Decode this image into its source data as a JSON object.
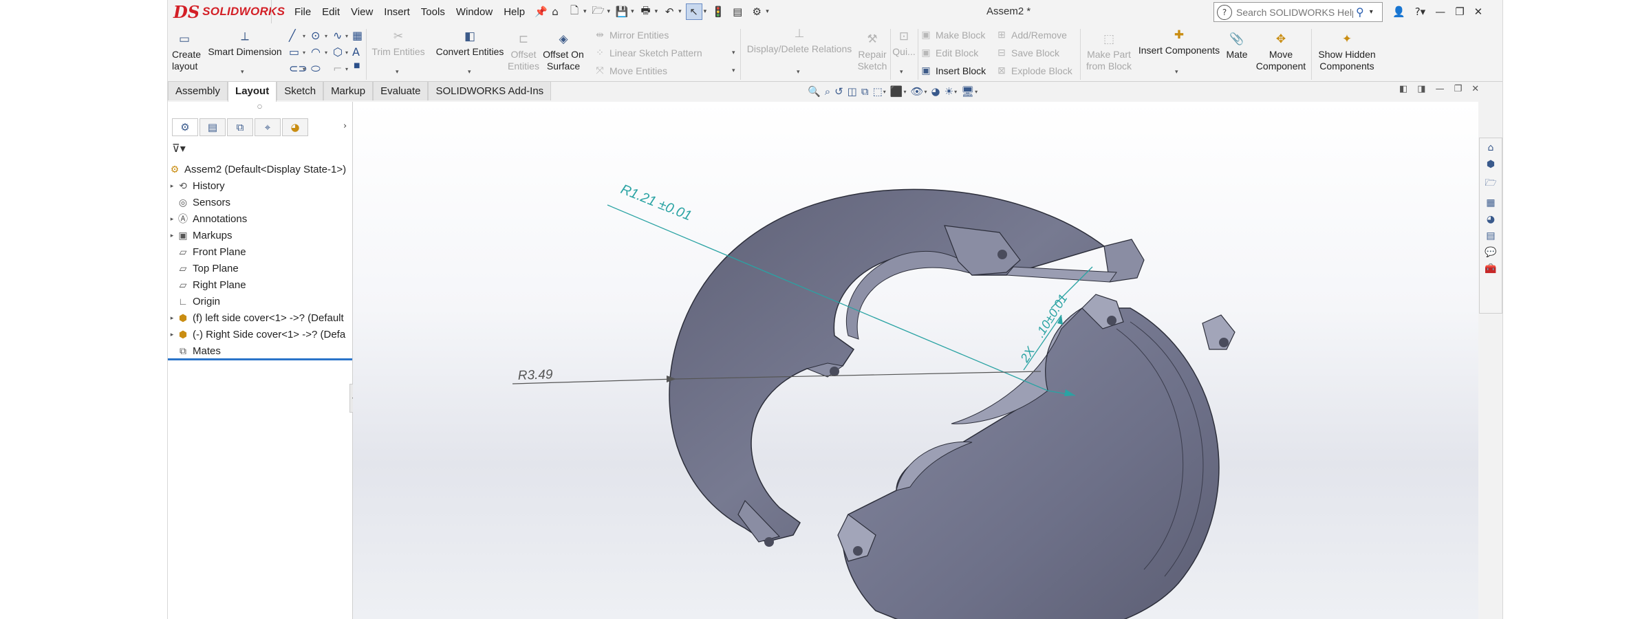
{
  "app": {
    "logo_mark": "DS",
    "logo_text": "SOLIDWORKS",
    "document_title": "Assem2 *"
  },
  "menu": [
    "File",
    "Edit",
    "View",
    "Insert",
    "Tools",
    "Window",
    "Help"
  ],
  "search": {
    "placeholder": "Search SOLIDWORKS Help"
  },
  "commands": {
    "create_layout": "Create layout",
    "smart_dimension": "Smart Dimension",
    "trim_entities": "Trim Entities",
    "convert_entities": "Convert Entities",
    "offset_entities": "Offset Entities",
    "offset_on_surface": "Offset On Surface",
    "mirror_entities": "Mirror Entities",
    "linear_sketch_pattern": "Linear Sketch Pattern",
    "move_entities": "Move Entities",
    "display_delete_relations": "Display/Delete Relations",
    "repair_sketch": "Repair Sketch",
    "quick_snaps": "Qui...",
    "make_block": "Make Block",
    "edit_block": "Edit Block",
    "insert_block": "Insert Block",
    "add_remove": "Add/Remove",
    "save_block": "Save Block",
    "explode_block": "Explode Block",
    "make_part_from_block": "Make Part from Block",
    "insert_components": "Insert Components",
    "mate": "Mate",
    "move_component": "Move Component",
    "show_hidden_components": "Show Hidden Components"
  },
  "tabs": [
    "Assembly",
    "Layout",
    "Sketch",
    "Markup",
    "Evaluate",
    "SOLIDWORKS Add-Ins"
  ],
  "active_tab": "Layout",
  "tree": {
    "root": "Assem2  (Default<Display State-1>)",
    "items": [
      {
        "label": "History",
        "expandable": true,
        "icon": "history-icon"
      },
      {
        "label": "Sensors",
        "expandable": false,
        "icon": "sensor-icon"
      },
      {
        "label": "Annotations",
        "expandable": true,
        "icon": "annotations-icon"
      },
      {
        "label": "Markups",
        "expandable": true,
        "icon": "markups-icon"
      },
      {
        "label": "Front Plane",
        "expandable": false,
        "icon": "plane-icon"
      },
      {
        "label": "Top Plane",
        "expandable": false,
        "icon": "plane-icon"
      },
      {
        "label": "Right Plane",
        "expandable": false,
        "icon": "plane-icon"
      },
      {
        "label": "Origin",
        "expandable": false,
        "icon": "origin-icon"
      },
      {
        "label": "(f) left side cover<1> ->? (Default",
        "expandable": true,
        "icon": "part-icon"
      },
      {
        "label": "(-) Right Side cover<1> ->? (Defa",
        "expandable": true,
        "icon": "part-icon"
      },
      {
        "label": "Mates",
        "expandable": false,
        "icon": "mates-icon"
      }
    ]
  },
  "dimensions": {
    "d1": "R1.21 ±0.01",
    "d2_prefix": "2X",
    "d2_value": ".10±0.01",
    "d3": "R3.49"
  },
  "colors": {
    "brand_red": "#d31f26",
    "dim_color": "#2aa3a3",
    "part_fill": "#6b6e86"
  }
}
